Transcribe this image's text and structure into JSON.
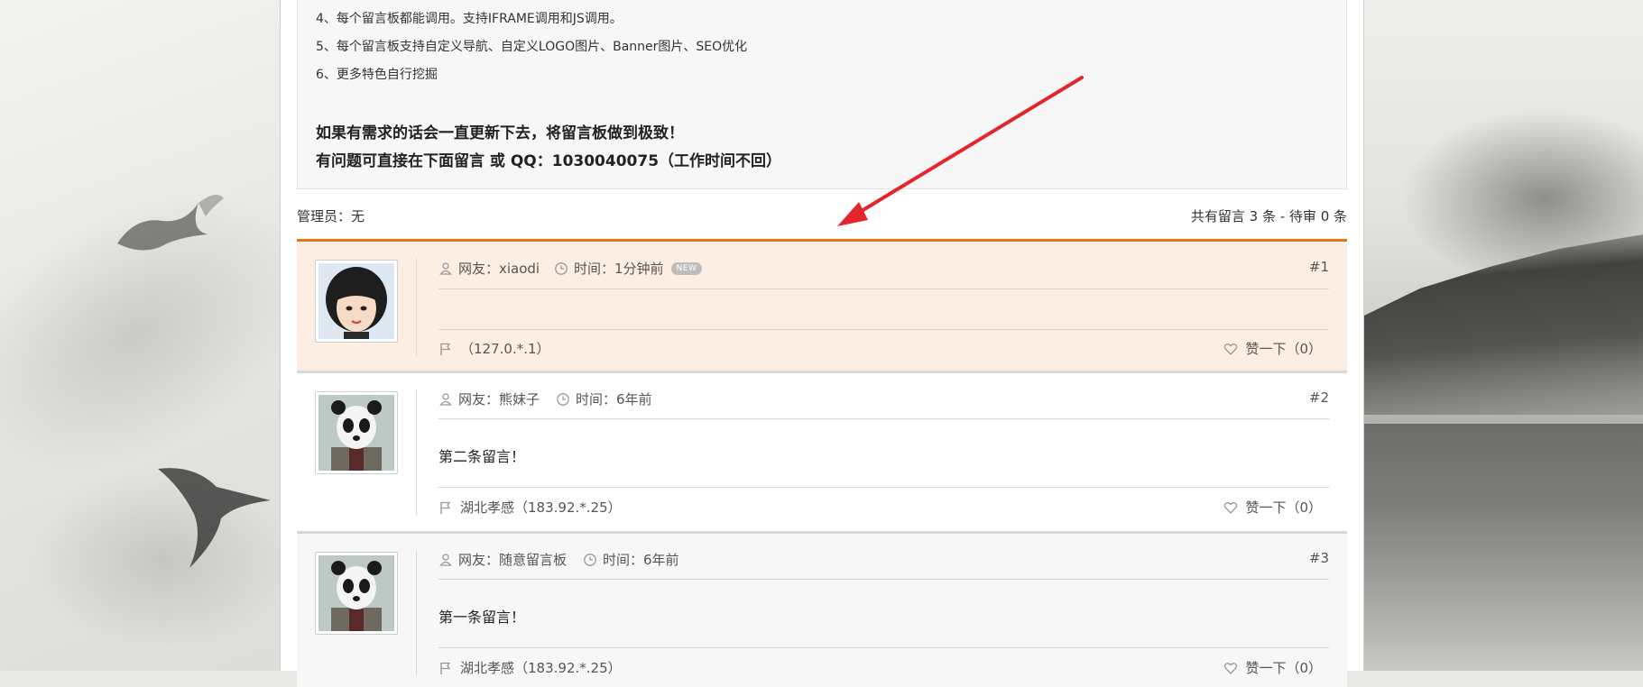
{
  "notice": {
    "lines": [
      "4、每个留言板都能调用。支持IFRAME调用和JS调用。",
      "5、每个留言板支持自定义导航、自定义LOGO图片、Banner图片、SEO优化",
      "6、更多特色自行挖掘"
    ],
    "highlight1": "如果有需求的话会一直更新下去，将留言板做到极致！",
    "highlight2": "有问题可直接在下面留言 或 QQ：1030040075（工作时间不回）"
  },
  "meta": {
    "admin": "管理员：无",
    "stats": "共有留言 3 条 - 待审 0 条"
  },
  "messages": [
    {
      "user": "网友：xiaodi",
      "time": "时间：1分钟前",
      "badge": "NEW",
      "number": "#1",
      "content": "",
      "location": "（127.0.*.1）",
      "like": "赞一下（0）"
    },
    {
      "user": "网友：熊妹子",
      "time": "时间：6年前",
      "number": "#2",
      "content": "第二条留言！",
      "location": "湖北孝感（183.92.*.25）",
      "like": "赞一下（0）"
    },
    {
      "user": "网友：随意留言板",
      "time": "时间：6年前",
      "number": "#3",
      "content": "第一条留言！",
      "location": "湖北孝感（183.92.*.25）",
      "like": "赞一下（0）"
    }
  ],
  "colors": {
    "accent": "#e8731f",
    "highlight_bg": "#fdeee4",
    "arrow": "#e3262b"
  }
}
